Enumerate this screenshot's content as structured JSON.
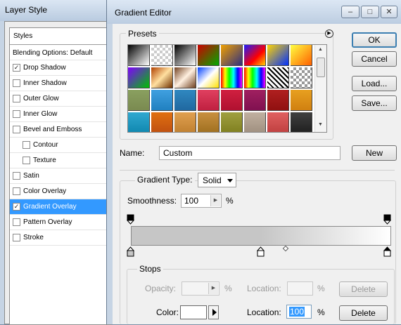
{
  "layer_style": {
    "title": "Layer Style",
    "styles_header": "Styles",
    "blending_options": "Blending Options: Default",
    "items": [
      {
        "label": "Drop Shadow",
        "checked": true,
        "selected": false,
        "indent": false
      },
      {
        "label": "Inner Shadow",
        "checked": false,
        "selected": false,
        "indent": false
      },
      {
        "label": "Outer Glow",
        "checked": false,
        "selected": false,
        "indent": false
      },
      {
        "label": "Inner Glow",
        "checked": false,
        "selected": false,
        "indent": false
      },
      {
        "label": "Bevel and Emboss",
        "checked": false,
        "selected": false,
        "indent": false
      },
      {
        "label": "Contour",
        "checked": false,
        "selected": false,
        "indent": true
      },
      {
        "label": "Texture",
        "checked": false,
        "selected": false,
        "indent": true
      },
      {
        "label": "Satin",
        "checked": false,
        "selected": false,
        "indent": false
      },
      {
        "label": "Color Overlay",
        "checked": false,
        "selected": false,
        "indent": false
      },
      {
        "label": "Gradient Overlay",
        "checked": true,
        "selected": true,
        "indent": false
      },
      {
        "label": "Pattern Overlay",
        "checked": false,
        "selected": false,
        "indent": false
      },
      {
        "label": "Stroke",
        "checked": false,
        "selected": false,
        "indent": false
      }
    ],
    "selected_color": "#3399ff"
  },
  "gradient_editor": {
    "title": "Gradient Editor",
    "window_buttons": {
      "minimize": "–",
      "maximize": "□",
      "close": "✕"
    },
    "presets_label": "Presets",
    "presets_menu_icon": "▶",
    "buttons": {
      "ok": "OK",
      "cancel": "Cancel",
      "load": "Load...",
      "save": "Save...",
      "new": "New"
    },
    "name_label": "Name:",
    "name_value": "Custom",
    "gradient_type_label": "Gradient Type:",
    "gradient_type_value": "Solid",
    "smoothness_label": "Smoothness:",
    "smoothness_value": "100",
    "smoothness_unit": "%",
    "gradient_stops": {
      "start_color": "#c6c6c6",
      "end_color": "#ffffff",
      "midpoint": 0.5
    },
    "stops": {
      "label": "Stops",
      "opacity_label": "Opacity:",
      "opacity_unit": "%",
      "opacity_location_label": "Location:",
      "opacity_location_unit": "%",
      "delete_label": "Delete",
      "color_label": "Color:",
      "color_value": "#ffffff",
      "color_location_label": "Location:",
      "color_location_value": "100",
      "color_location_unit": "%"
    }
  },
  "preset_swatches": [
    "linear-gradient(135deg,#000 0%,#fff 100%)",
    "repeating-conic-gradient(#ccc 0 25%,#fff 0 50%) 0 0/8px 8px",
    "linear-gradient(135deg,#000 0%,#fff 100%)",
    "linear-gradient(135deg,#c00 0%,#0a0 100%)",
    "linear-gradient(135deg,#f0a000 0%,#303080 100%)",
    "linear-gradient(135deg,#1a1aff 0%,#ff0000 60%,#ffd000 100%)",
    "linear-gradient(135deg,#ffd400 0%,#0030ff 100%)",
    "linear-gradient(135deg,#ffff40 0%,#ff6000 100%)",
    "linear-gradient(135deg,#8000ff 0%,#00c000 100%)",
    "linear-gradient(135deg,#b04000 0%,#ffe0a0 50%,#703000 100%)",
    "linear-gradient(135deg,#704020 0%,#fff0e0 50%,#704020 100%)",
    "linear-gradient(135deg,#0040ff 0%,#fff 50%,#ffe000 100%)",
    "linear-gradient(90deg,#f00,#ff0,#0f0,#0ff,#00f,#f0f)",
    "linear-gradient(90deg,#f00,#ff0,#0f0,#0ff,#00f,#f0f)",
    "repeating-linear-gradient(45deg,#000 0 2px,#fff 2px 5px)",
    "repeating-conic-gradient(#999 0 25%,#fff 0 50%) 0 0/8px 8px",
    "linear-gradient(#8aa060,#7a8a50)",
    "linear-gradient(#40a0e0,#2080c0)",
    "linear-gradient(#3088c0,#2068a0)",
    "linear-gradient(#e04060,#c02040)",
    "linear-gradient(#d02040,#b01030)",
    "linear-gradient(#a02060,#801050)",
    "linear-gradient(#b02020,#901010)",
    "linear-gradient(#e8a020,#d08010)",
    "linear-gradient(#30a8d0,#1088b0)",
    "linear-gradient(#e07010,#c05010)",
    "linear-gradient(#e0a050,#c08030)",
    "linear-gradient(#c89040,#a07020)",
    "linear-gradient(#a0a040,#808020)",
    "linear-gradient(#c0b0a0,#a09080)",
    "linear-gradient(#e06060,#c04040)",
    "linear-gradient(#404040,#202020)"
  ]
}
